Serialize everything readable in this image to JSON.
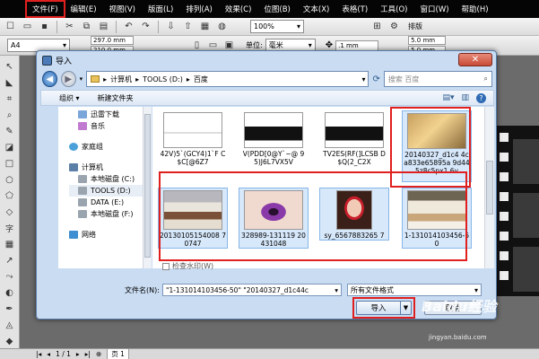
{
  "menubar": {
    "items": [
      "文件(F)",
      "编辑(E)",
      "视图(V)",
      "版面(L)",
      "排列(A)",
      "效果(C)",
      "位图(B)",
      "文本(X)",
      "表格(T)",
      "工具(O)",
      "窗口(W)",
      "帮助(H)"
    ]
  },
  "toolbar1": {
    "zoom": "100%",
    "layout_label": "排版"
  },
  "toolbar2": {
    "paper": "A4",
    "width": "297.0 mm",
    "height": "210.0 mm",
    "unit_label": "单位:",
    "unit_value": "毫米",
    "nudge": ".1 mm",
    "dup_x": "5.0 mm",
    "dup_y": "5.0 mm"
  },
  "dialog": {
    "title": "导入",
    "close": "✕",
    "address": {
      "segments": [
        "计算机",
        "TOOLS (D:)",
        "百度"
      ]
    },
    "search_placeholder": "搜索 百度",
    "commands": {
      "organize": "组织 ▾",
      "new_folder": "新建文件夹"
    },
    "nav": {
      "items": [
        "迅雷下载",
        "音乐",
        "家庭组",
        "计算机",
        "本地磁盘 (C:)",
        "TOOLS (D:)",
        "DATA (E:)",
        "本地磁盘 (F:)",
        "网络"
      ]
    },
    "files": {
      "row1": [
        {
          "name": "42V)5`(GCY4)1`F C$C[@6Z7"
        },
        {
          "name": "V(PDD[0@Y`~@ 95)J6L7VX5V"
        },
        {
          "name": "TV2ES(RF(]LCSB D$Q(2_C2X"
        },
        {
          "name": "20140327_d1c4 4ca833e65895a 9d445z8c5px1 6v"
        }
      ],
      "row2": [
        {
          "name": "20130105154008 70747"
        },
        {
          "name": "328989-131119 20431048"
        },
        {
          "name": "sy_6567883265 7"
        },
        {
          "name": "1-131014103456-50"
        }
      ]
    },
    "watermark_check": "检查水印(W)",
    "filename_label": "文件名(N):",
    "filename_value": "\"1-131014103456-50\" \"20140327_d1c44c",
    "filetype": "所有文件格式",
    "import_label": "导入",
    "cancel_label": "取消"
  },
  "statusbar": {
    "pages": "1 / 1",
    "page_tab": "页 1"
  },
  "watermarks": {
    "brand": "Baidu经验",
    "url": "jingyan.baidu.com"
  }
}
